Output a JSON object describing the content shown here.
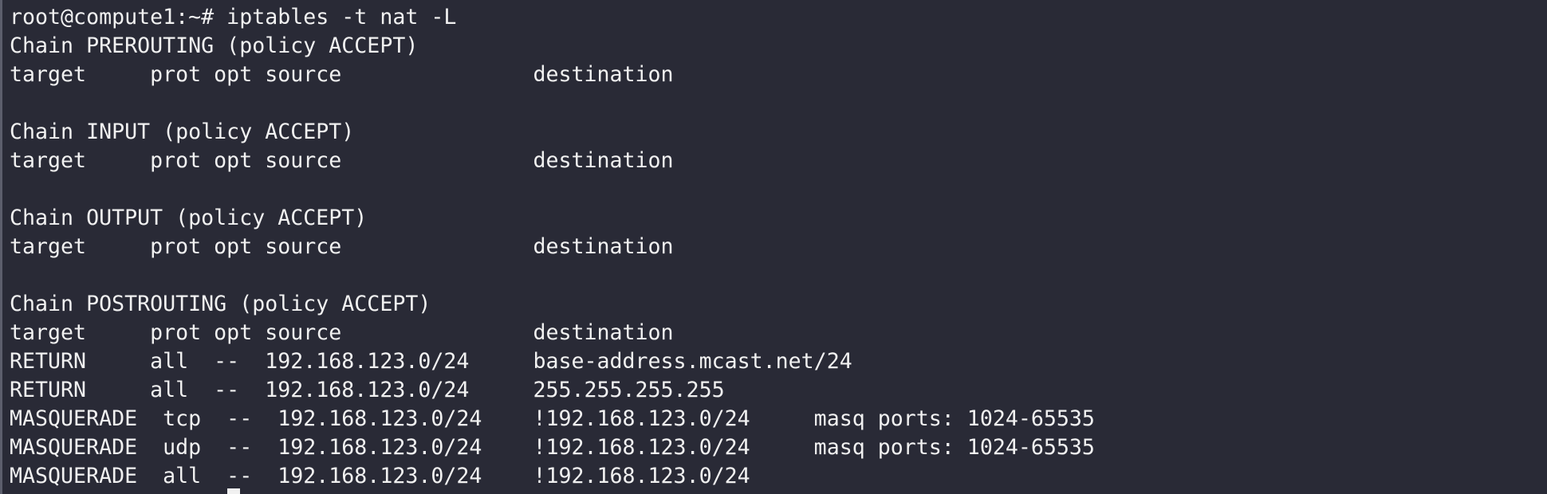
{
  "terminal": {
    "lines": [
      "root@compute1:~# iptables -t nat -L",
      "Chain PREROUTING (policy ACCEPT)",
      "target     prot opt source               destination",
      "",
      "Chain INPUT (policy ACCEPT)",
      "target     prot opt source               destination",
      "",
      "Chain OUTPUT (policy ACCEPT)",
      "target     prot opt source               destination",
      "",
      "Chain POSTROUTING (policy ACCEPT)",
      "target     prot opt source               destination",
      "RETURN     all  --  192.168.123.0/24     base-address.mcast.net/24",
      "RETURN     all  --  192.168.123.0/24     255.255.255.255",
      "MASQUERADE  tcp  --  192.168.123.0/24    !192.168.123.0/24     masq ports: 1024-65535",
      "MASQUERADE  udp  --  192.168.123.0/24    !192.168.123.0/24     masq ports: 1024-65535",
      "MASQUERADE  all  --  192.168.123.0/24    !192.168.123.0/24"
    ]
  },
  "colors": {
    "background": "#292a36",
    "text": "#f1f1f1"
  }
}
